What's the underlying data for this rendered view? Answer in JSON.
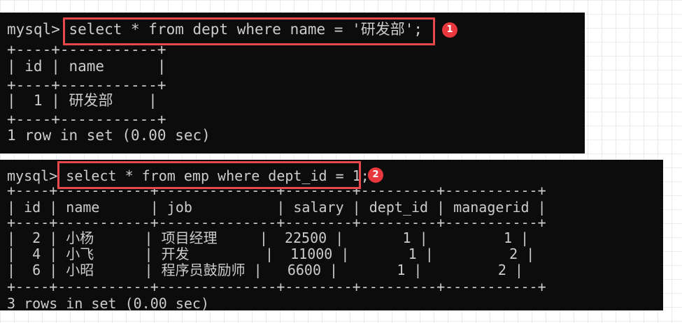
{
  "annotations": {
    "badge1": "1",
    "badge2": "2"
  },
  "terminal1": {
    "prompt": "mysql>",
    "command": "select * from dept where name = '研发部';",
    "table_lines": [
      "+----+-----------+",
      "| id | name      |",
      "+----+-----------+",
      "|  1 | 研发部    |",
      "+----+-----------+"
    ],
    "result": "1 row in set (0.00 sec)"
  },
  "terminal2": {
    "prompt": "mysql>",
    "command": "select * from emp where dept_id = 1;",
    "table_lines": [
      "+----+-----------+--------------+--------+---------+-----------+",
      "| id | name      | job          | salary | dept_id | managerid |",
      "+----+-----------+--------------+--------+---------+-----------+",
      "|  2 | 小杨      | 项目经理     |  22500 |       1 |         1 |",
      "|  4 | 小飞      | 开发         |  11000 |       1 |         2 |",
      "|  6 | 小昭      | 程序员鼓励师 |   6600 |       1 |         2 |",
      "+----+-----------+--------------+--------+---------+-----------+"
    ],
    "result": "3 rows in set (0.00 sec)"
  }
}
